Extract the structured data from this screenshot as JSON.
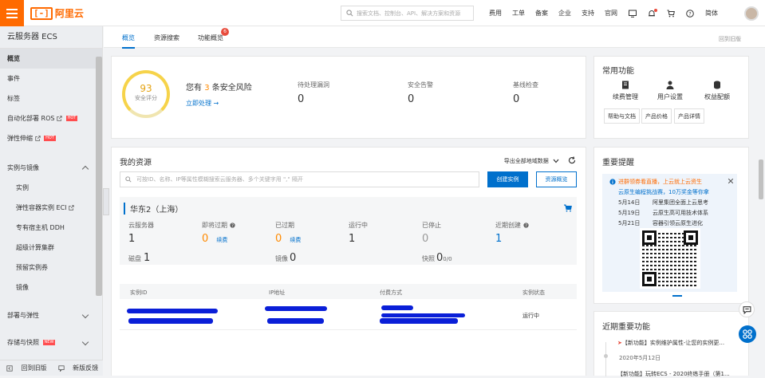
{
  "header": {
    "logo_text": "阿里云",
    "search_placeholder": "搜索文档、控制台、API、解决方案和资源",
    "nav": [
      "费用",
      "工单",
      "备案",
      "企业",
      "支持",
      "官网"
    ],
    "lang": "简体"
  },
  "sidebar": {
    "title": "云服务器 ECS",
    "items": [
      {
        "label": "概览",
        "active": true
      },
      {
        "label": "事件"
      },
      {
        "label": "标签"
      },
      {
        "label": "自动化部署 ROS",
        "badge": "HOT"
      },
      {
        "label": "弹性伸缩",
        "badge": "HOT"
      }
    ],
    "group_instances": "实例与镜像",
    "instance_items": [
      "实例",
      "弹性容器实例 ECI",
      "专有宿主机 DDH",
      "超级计算集群",
      "预留实例券",
      "镜像"
    ],
    "group_deploy": "部署与弹性",
    "group_storage": "存储与快照",
    "storage_badge": "NEW",
    "footer_back": "回到旧版",
    "footer_feedback": "新版反馈"
  },
  "tabs": {
    "items": [
      "概览",
      "资源搜索",
      "功能概览"
    ],
    "func_badge": "6",
    "back_old": "回到旧版"
  },
  "security": {
    "score": "93",
    "score_label": "安全评分",
    "risk_prefix": "您有",
    "risk_count": "3",
    "risk_suffix": "条安全风险",
    "fix_link": "立即处理 →",
    "stats": [
      {
        "label": "待处理漏洞",
        "value": "0"
      },
      {
        "label": "安全告警",
        "value": "0"
      },
      {
        "label": "基线检查",
        "value": "0"
      }
    ]
  },
  "common_functions": {
    "title": "常用功能",
    "icons": [
      "续费管理",
      "用户设置",
      "权益配额"
    ],
    "buttons": [
      "帮助与文档",
      "产品价格",
      "产品详情"
    ]
  },
  "resources": {
    "title": "我的资源",
    "export_label": "导出全部地域数据",
    "filter_placeholder": "可按ID、名称、IP等属性模糊搜索云服务器、多个关键字用 \",\" 隔开",
    "create_button": "创建实例",
    "overview_button": "资源概览",
    "region": "华东2（上海）",
    "stats": [
      {
        "label": "云服务器",
        "value": "1"
      },
      {
        "label": "即将过期",
        "value": "0",
        "link": "续费"
      },
      {
        "label": "已过期",
        "value": "0",
        "link": "续费"
      },
      {
        "label": "运行中",
        "value": "1"
      },
      {
        "label": "已停止",
        "value": "0"
      },
      {
        "label": "近期创建",
        "value": "1"
      }
    ],
    "disk_label": "磁盘",
    "disk_value": "1",
    "image_label": "镜像",
    "image_value": "0",
    "snapshot_label": "快照",
    "snapshot_value": "0",
    "snapshot_sub": "0/0",
    "table_headers": [
      "实例ID",
      "IP地址",
      "付费方式",
      "实例状态"
    ],
    "row_status": "运行中"
  },
  "notices": {
    "title": "重要提醒",
    "headline": "进群领券看直播，上云就上云资生",
    "subline": "云原生编程挑战赛，10万奖金等你拿",
    "events": [
      {
        "date": "5月14日",
        "text": "阿里集团全面上云思考"
      },
      {
        "date": "5月19日",
        "text": "云原生高可用技术体系"
      },
      {
        "date": "5月21日",
        "text": "容器引领云原生进化"
      }
    ]
  },
  "new_features": {
    "title": "近期重要功能",
    "items": [
      {
        "text": "【新功能】实例维护属性-让您的实例更...",
        "date": "2020年5月12日"
      },
      {
        "text": "【新功能】玩转ECS - 2020终练手册（第1..."
      }
    ]
  },
  "colors": {
    "brand": "#ff6a00",
    "primary": "#0070cc",
    "warning": "#ff8a00",
    "danger": "#e84c3d"
  }
}
